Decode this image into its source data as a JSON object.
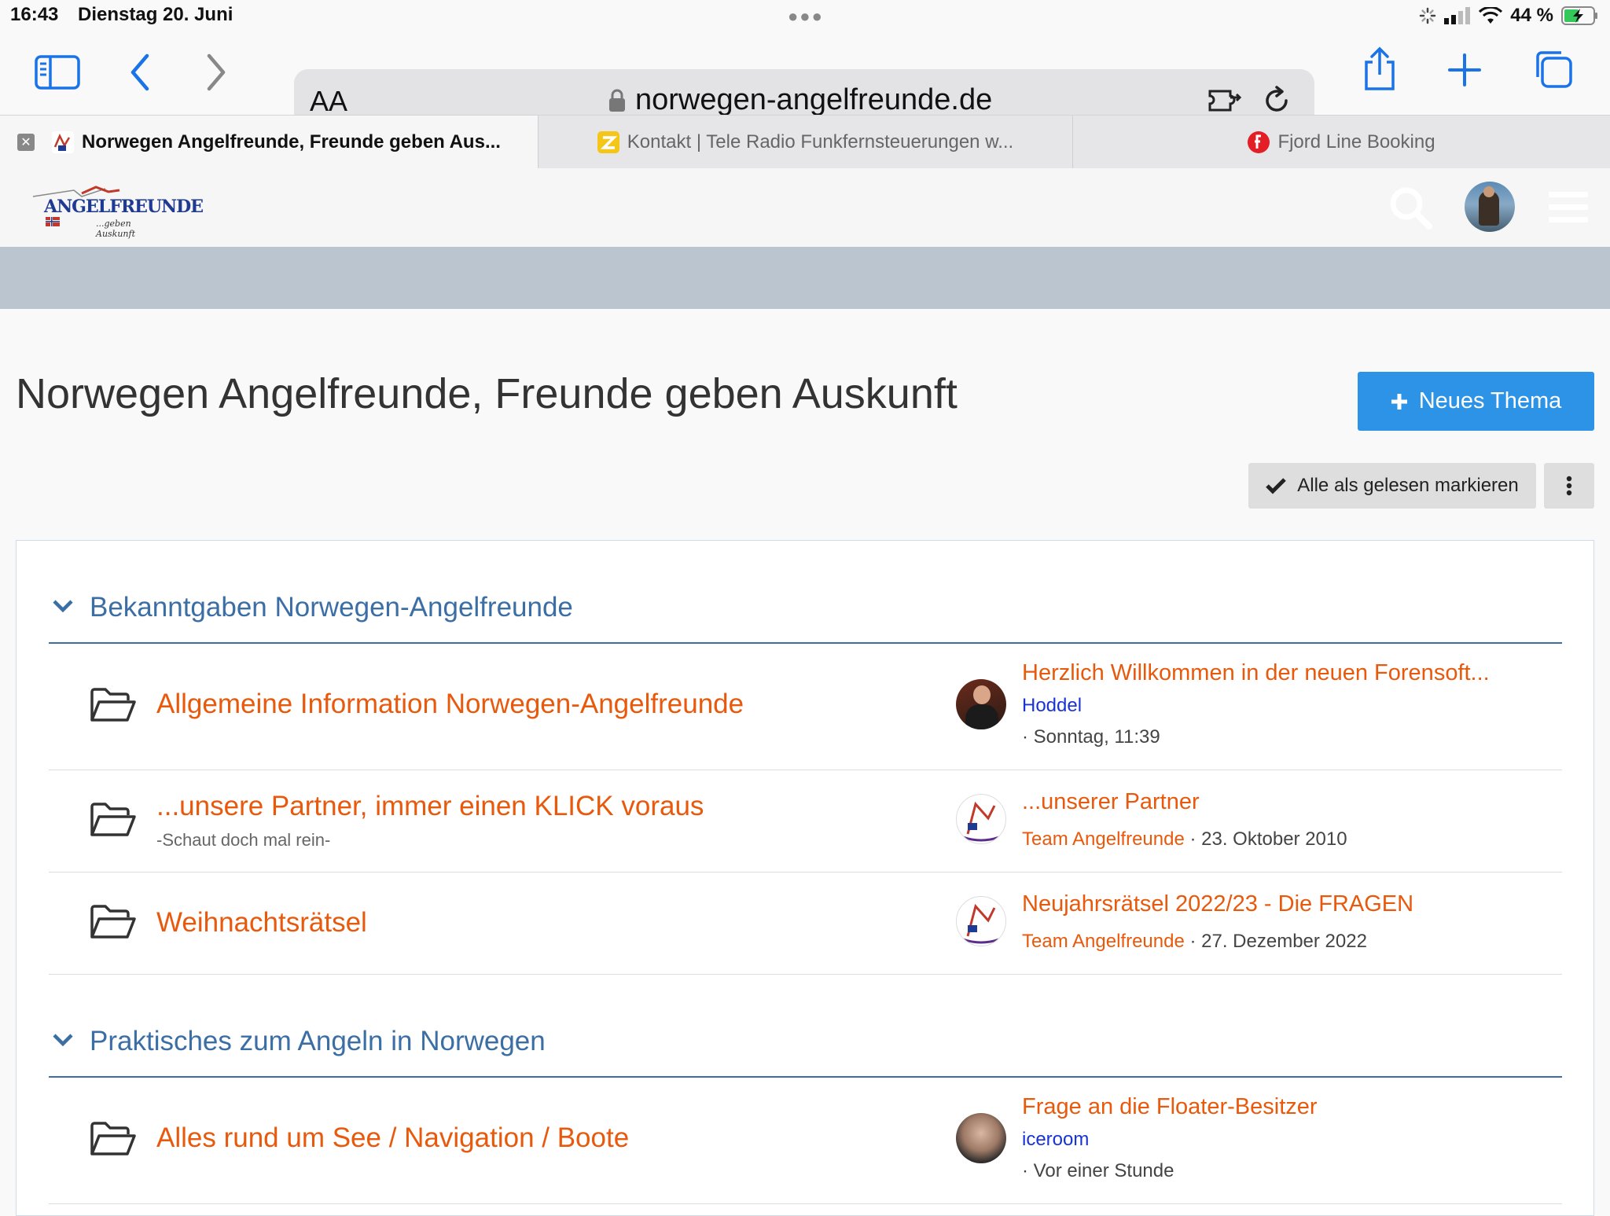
{
  "status_bar": {
    "time": "16:43",
    "date": "Dienstag 20. Juni",
    "battery": "44 %"
  },
  "browser": {
    "aa_label": "AA",
    "url": "norwegen-angelfreunde.de",
    "tabs": [
      {
        "title": "Norwegen Angelfreunde, Freunde geben Aus...",
        "active": true
      },
      {
        "title": "Kontakt | Tele Radio Funkfernsteuerungen w...",
        "active": false
      },
      {
        "title": "Fjord Line Booking",
        "active": false
      }
    ]
  },
  "site": {
    "logo_text": "ANGELFREUNDE",
    "logo_tagline": "...geben Auskunft"
  },
  "page": {
    "title": "Norwegen Angelfreunde, Freunde geben Auskunft",
    "new_topic_label": "Neues Thema",
    "mark_read_label": "Alle als gelesen markieren"
  },
  "categories": [
    {
      "title": "Bekanntgaben Norwegen-Angelfreunde",
      "boards": [
        {
          "name": "Allgemeine Information Norwegen-Angelfreunde",
          "last_post": "Herzlich Willkommen in der neuen Forensoft...",
          "user": "Hoddel",
          "time": "· Sonntag, 11:39"
        },
        {
          "name": "...unsere Partner, immer einen KLICK voraus",
          "description": "-Schaut doch mal rein-",
          "last_post": "...unserer Partner",
          "user": "Team Angelfreunde",
          "time": " · 23. Oktober 2010"
        },
        {
          "name": "Weihnachtsrätsel",
          "last_post": "Neujahrsrätsel 2022/23 - Die FRAGEN",
          "user": "Team Angelfreunde",
          "time": " · 27. Dezember 2022"
        }
      ]
    },
    {
      "title": "Praktisches zum Angeln in Norwegen",
      "boards": [
        {
          "name": "Alles rund um See / Navigation / Boote",
          "last_post": "Frage an die Floater-Besitzer",
          "user": "iceroom",
          "time": "· Vor einer Stunde"
        }
      ]
    }
  ],
  "colors": {
    "accent_blue": "#2c93e6",
    "category_blue": "#3a6ea5",
    "link_orange": "#e8590c",
    "user_blue": "#1733d6",
    "safari_blue": "#1a73e8"
  }
}
